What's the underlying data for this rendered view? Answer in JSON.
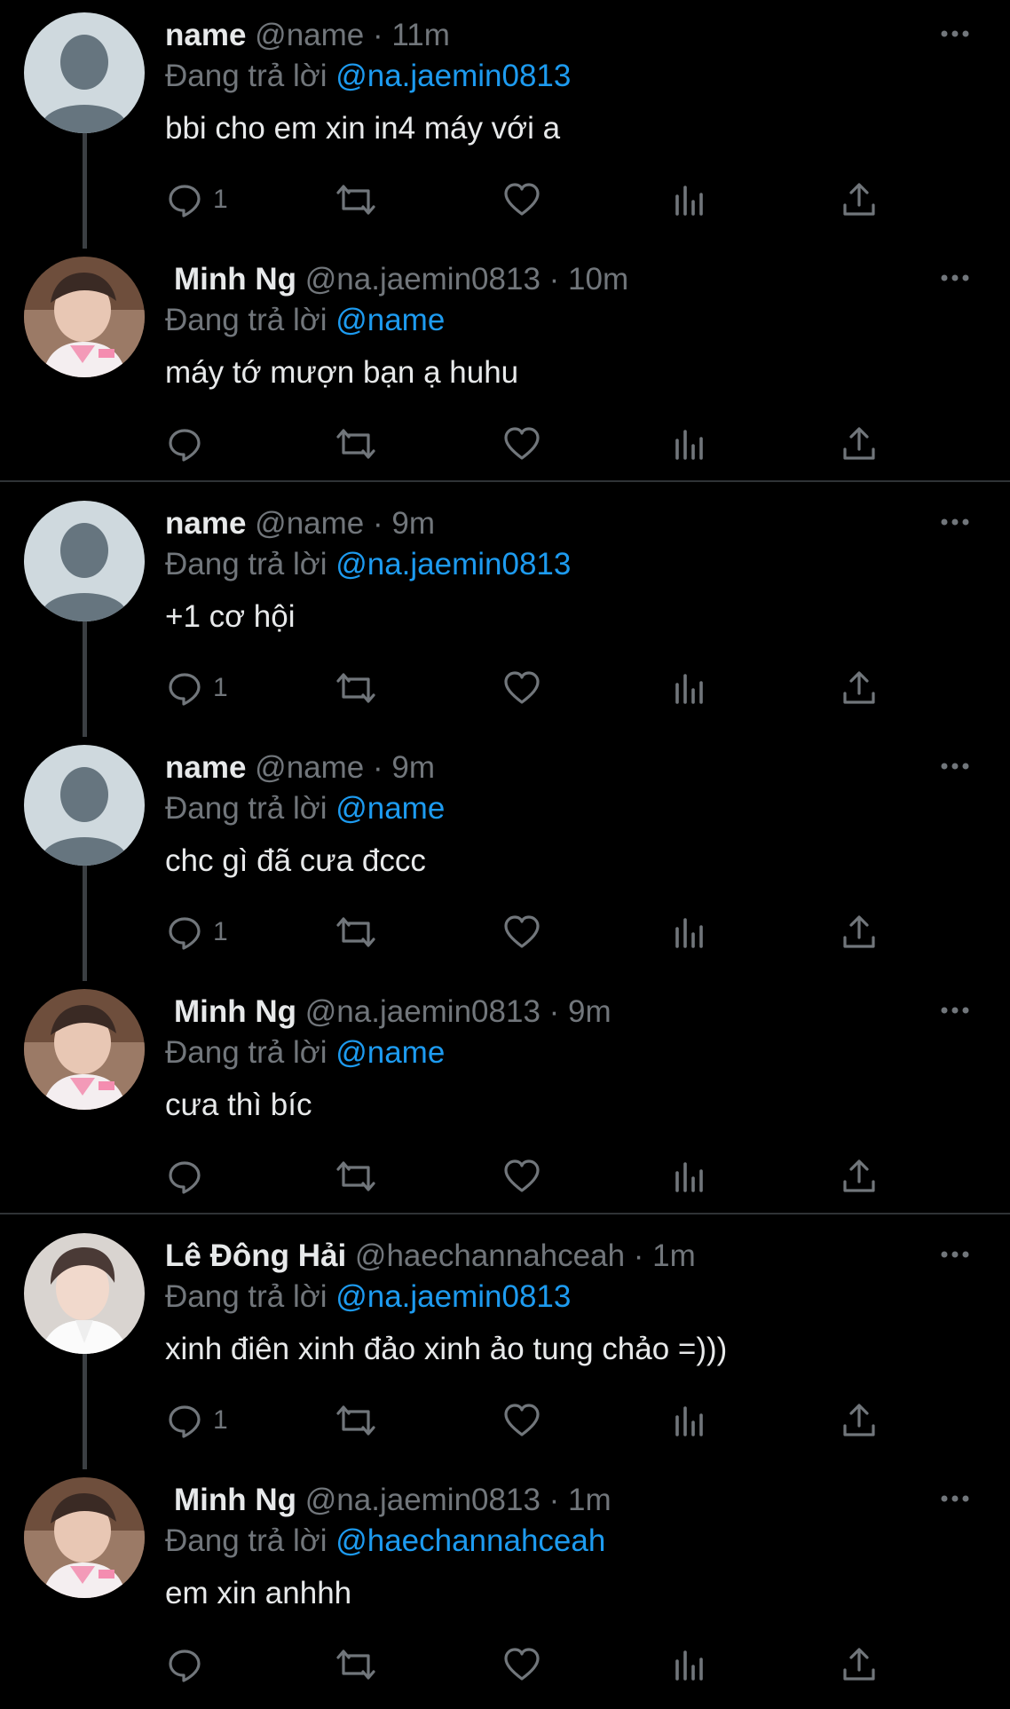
{
  "app": {
    "background": "#000000",
    "accent": "#1d9bf0",
    "muted": "#71767b"
  },
  "reply_prefix": "Đang trả lời",
  "tweets": [
    {
      "name": "name",
      "handle": "@name",
      "time": "11m",
      "reply_to": "@na.jaemin0813",
      "text": "bbi cho em xin in4 máy với a",
      "reply_count": "1",
      "avatar": "default-avatar"
    },
    {
      "name": "Minh Ng",
      "handle": "@na.jaemin0813",
      "time": "10m",
      "reply_to": "@name",
      "text": "máy tớ mượn bạn ạ huhu",
      "reply_count": "",
      "avatar": "minh-photo-avatar"
    },
    {
      "name": "name",
      "handle": "@name",
      "time": "9m",
      "reply_to": "@na.jaemin0813",
      "text": "+1 cơ hội",
      "reply_count": "1",
      "avatar": "default-avatar"
    },
    {
      "name": "name",
      "handle": "@name",
      "time": "9m",
      "reply_to": "@name",
      "text": "chc gì đã cưa đccc",
      "reply_count": "1",
      "avatar": "default-avatar"
    },
    {
      "name": "Minh Ng",
      "handle": "@na.jaemin0813",
      "time": "9m",
      "reply_to": "@name",
      "text": "cưa thì bíc",
      "reply_count": "",
      "avatar": "minh-photo-avatar"
    },
    {
      "name": "Lê Đông Hải",
      "handle": "@haechannahceah",
      "time": "1m",
      "reply_to": "@na.jaemin0813",
      "text": "xinh điên xinh đảo xinh ảo tung chảo =)))",
      "reply_count": "1",
      "avatar": "hai-photo-avatar"
    },
    {
      "name": "Minh Ng",
      "handle": "@na.jaemin0813",
      "time": "1m",
      "reply_to": "@haechannahceah",
      "text": "em xin anhhh",
      "reply_count": "",
      "avatar": "minh-photo-avatar"
    }
  ]
}
